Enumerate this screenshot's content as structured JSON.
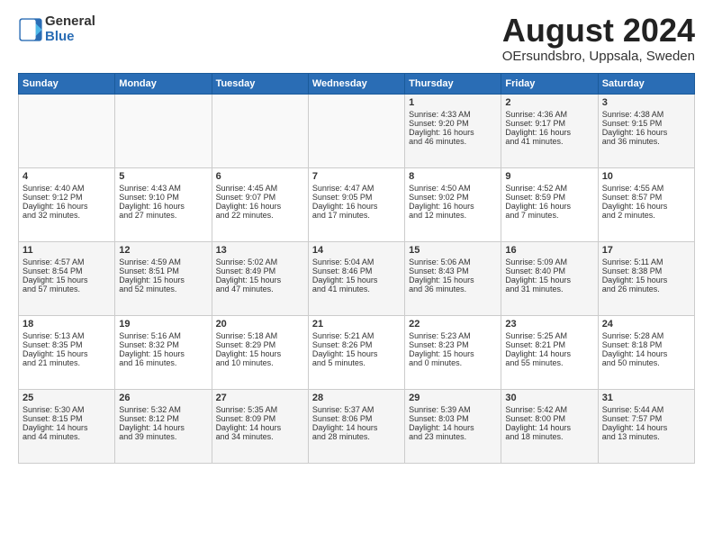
{
  "header": {
    "logo_line1": "General",
    "logo_line2": "Blue",
    "month_title": "August 2024",
    "subtitle": "OErsundsbro, Uppsala, Sweden"
  },
  "days_of_week": [
    "Sunday",
    "Monday",
    "Tuesday",
    "Wednesday",
    "Thursday",
    "Friday",
    "Saturday"
  ],
  "weeks": [
    [
      {
        "day": "",
        "content": ""
      },
      {
        "day": "",
        "content": ""
      },
      {
        "day": "",
        "content": ""
      },
      {
        "day": "",
        "content": ""
      },
      {
        "day": "1",
        "content": "Sunrise: 4:33 AM\nSunset: 9:20 PM\nDaylight: 16 hours\nand 46 minutes."
      },
      {
        "day": "2",
        "content": "Sunrise: 4:36 AM\nSunset: 9:17 PM\nDaylight: 16 hours\nand 41 minutes."
      },
      {
        "day": "3",
        "content": "Sunrise: 4:38 AM\nSunset: 9:15 PM\nDaylight: 16 hours\nand 36 minutes."
      }
    ],
    [
      {
        "day": "4",
        "content": "Sunrise: 4:40 AM\nSunset: 9:12 PM\nDaylight: 16 hours\nand 32 minutes."
      },
      {
        "day": "5",
        "content": "Sunrise: 4:43 AM\nSunset: 9:10 PM\nDaylight: 16 hours\nand 27 minutes."
      },
      {
        "day": "6",
        "content": "Sunrise: 4:45 AM\nSunset: 9:07 PM\nDaylight: 16 hours\nand 22 minutes."
      },
      {
        "day": "7",
        "content": "Sunrise: 4:47 AM\nSunset: 9:05 PM\nDaylight: 16 hours\nand 17 minutes."
      },
      {
        "day": "8",
        "content": "Sunrise: 4:50 AM\nSunset: 9:02 PM\nDaylight: 16 hours\nand 12 minutes."
      },
      {
        "day": "9",
        "content": "Sunrise: 4:52 AM\nSunset: 8:59 PM\nDaylight: 16 hours\nand 7 minutes."
      },
      {
        "day": "10",
        "content": "Sunrise: 4:55 AM\nSunset: 8:57 PM\nDaylight: 16 hours\nand 2 minutes."
      }
    ],
    [
      {
        "day": "11",
        "content": "Sunrise: 4:57 AM\nSunset: 8:54 PM\nDaylight: 15 hours\nand 57 minutes."
      },
      {
        "day": "12",
        "content": "Sunrise: 4:59 AM\nSunset: 8:51 PM\nDaylight: 15 hours\nand 52 minutes."
      },
      {
        "day": "13",
        "content": "Sunrise: 5:02 AM\nSunset: 8:49 PM\nDaylight: 15 hours\nand 47 minutes."
      },
      {
        "day": "14",
        "content": "Sunrise: 5:04 AM\nSunset: 8:46 PM\nDaylight: 15 hours\nand 41 minutes."
      },
      {
        "day": "15",
        "content": "Sunrise: 5:06 AM\nSunset: 8:43 PM\nDaylight: 15 hours\nand 36 minutes."
      },
      {
        "day": "16",
        "content": "Sunrise: 5:09 AM\nSunset: 8:40 PM\nDaylight: 15 hours\nand 31 minutes."
      },
      {
        "day": "17",
        "content": "Sunrise: 5:11 AM\nSunset: 8:38 PM\nDaylight: 15 hours\nand 26 minutes."
      }
    ],
    [
      {
        "day": "18",
        "content": "Sunrise: 5:13 AM\nSunset: 8:35 PM\nDaylight: 15 hours\nand 21 minutes."
      },
      {
        "day": "19",
        "content": "Sunrise: 5:16 AM\nSunset: 8:32 PM\nDaylight: 15 hours\nand 16 minutes."
      },
      {
        "day": "20",
        "content": "Sunrise: 5:18 AM\nSunset: 8:29 PM\nDaylight: 15 hours\nand 10 minutes."
      },
      {
        "day": "21",
        "content": "Sunrise: 5:21 AM\nSunset: 8:26 PM\nDaylight: 15 hours\nand 5 minutes."
      },
      {
        "day": "22",
        "content": "Sunrise: 5:23 AM\nSunset: 8:23 PM\nDaylight: 15 hours\nand 0 minutes."
      },
      {
        "day": "23",
        "content": "Sunrise: 5:25 AM\nSunset: 8:21 PM\nDaylight: 14 hours\nand 55 minutes."
      },
      {
        "day": "24",
        "content": "Sunrise: 5:28 AM\nSunset: 8:18 PM\nDaylight: 14 hours\nand 50 minutes."
      }
    ],
    [
      {
        "day": "25",
        "content": "Sunrise: 5:30 AM\nSunset: 8:15 PM\nDaylight: 14 hours\nand 44 minutes."
      },
      {
        "day": "26",
        "content": "Sunrise: 5:32 AM\nSunset: 8:12 PM\nDaylight: 14 hours\nand 39 minutes."
      },
      {
        "day": "27",
        "content": "Sunrise: 5:35 AM\nSunset: 8:09 PM\nDaylight: 14 hours\nand 34 minutes."
      },
      {
        "day": "28",
        "content": "Sunrise: 5:37 AM\nSunset: 8:06 PM\nDaylight: 14 hours\nand 28 minutes."
      },
      {
        "day": "29",
        "content": "Sunrise: 5:39 AM\nSunset: 8:03 PM\nDaylight: 14 hours\nand 23 minutes."
      },
      {
        "day": "30",
        "content": "Sunrise: 5:42 AM\nSunset: 8:00 PM\nDaylight: 14 hours\nand 18 minutes."
      },
      {
        "day": "31",
        "content": "Sunrise: 5:44 AM\nSunset: 7:57 PM\nDaylight: 14 hours\nand 13 minutes."
      }
    ]
  ]
}
